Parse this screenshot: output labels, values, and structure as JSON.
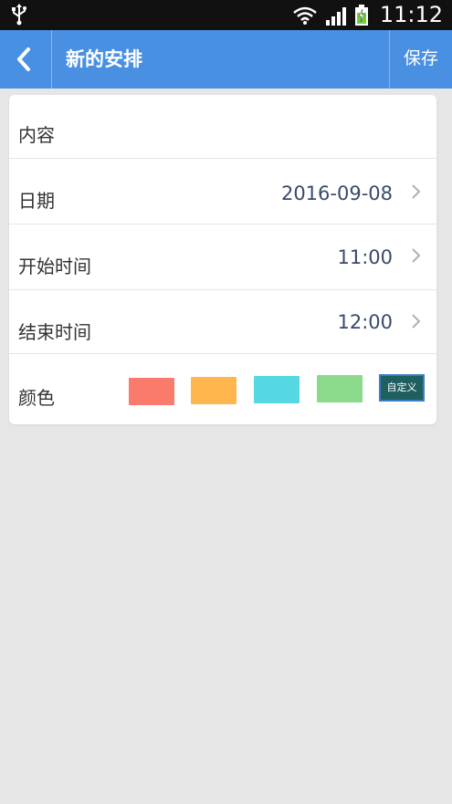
{
  "status_bar": {
    "time": "11:12",
    "icons": [
      "usb-icon",
      "wifi-icon",
      "signal-icon",
      "battery-charging-icon"
    ]
  },
  "nav": {
    "title": "新的安排",
    "save_label": "保存",
    "back_icon": "chevron-left-icon"
  },
  "form": {
    "content_label": "内容",
    "date_label": "日期",
    "date_value": "2016-09-08",
    "start_label": "开始时间",
    "start_value": "11:00",
    "end_label": "结束时间",
    "end_value": "12:00",
    "color_label": "颜色",
    "custom_label": "自定义"
  },
  "colors": {
    "primary": "#4a90e2",
    "swatches": [
      "#fa7b6b",
      "#ffb74d",
      "#55d8e2",
      "#8bd98b"
    ],
    "custom_bg": "#1f5f5f"
  }
}
